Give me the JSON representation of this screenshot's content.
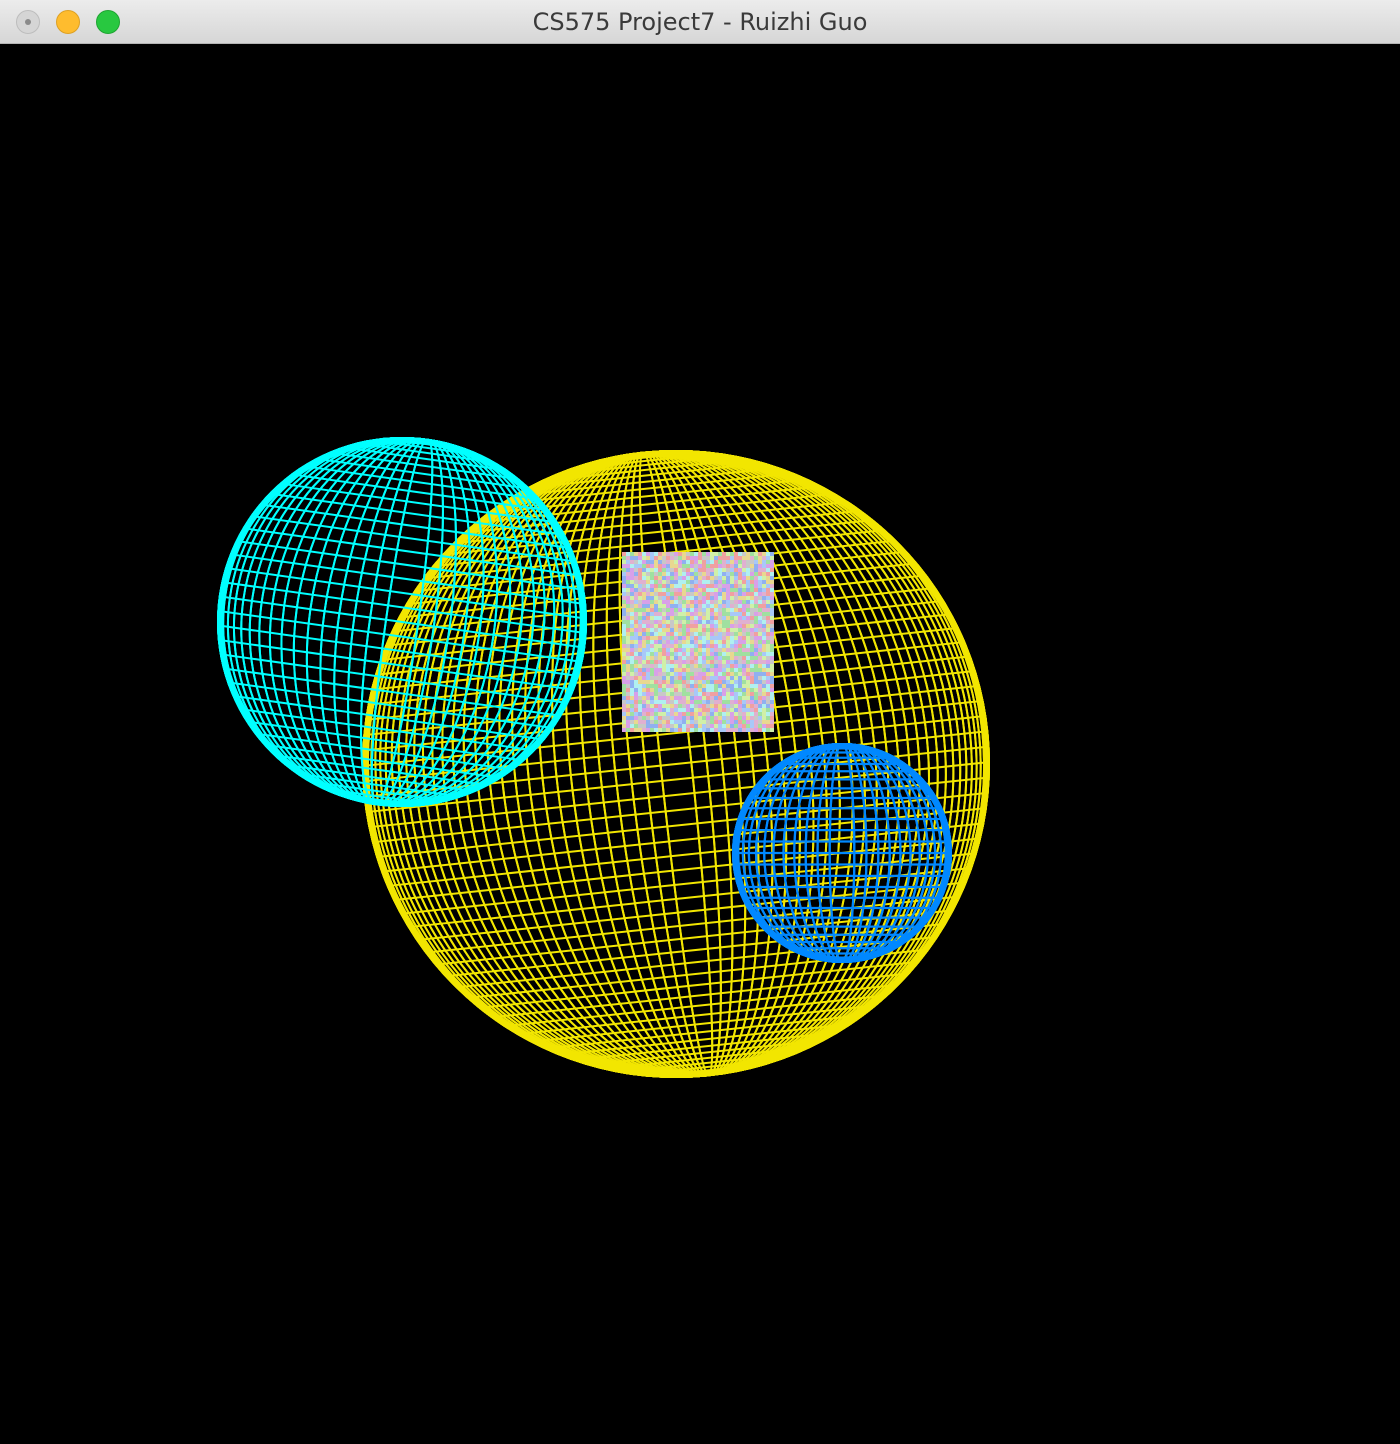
{
  "window": {
    "title": "CS575 Project7 - Ruizhi Guo"
  },
  "scene": {
    "background_color": "#000000",
    "objects": [
      {
        "name": "yellow-sphere",
        "kind": "wireframe-sphere",
        "color": "#f2e600"
      },
      {
        "name": "cyan-sphere",
        "kind": "wireframe-sphere",
        "color": "#00ffff"
      },
      {
        "name": "blue-sphere",
        "kind": "wireframe-sphere",
        "color": "#0088ff"
      },
      {
        "name": "noise-textured-quad",
        "kind": "textured-quad",
        "texture": "random-noise"
      }
    ]
  },
  "icons": {
    "close": "close-icon",
    "minimize": "minimize-icon",
    "zoom": "zoom-icon"
  }
}
